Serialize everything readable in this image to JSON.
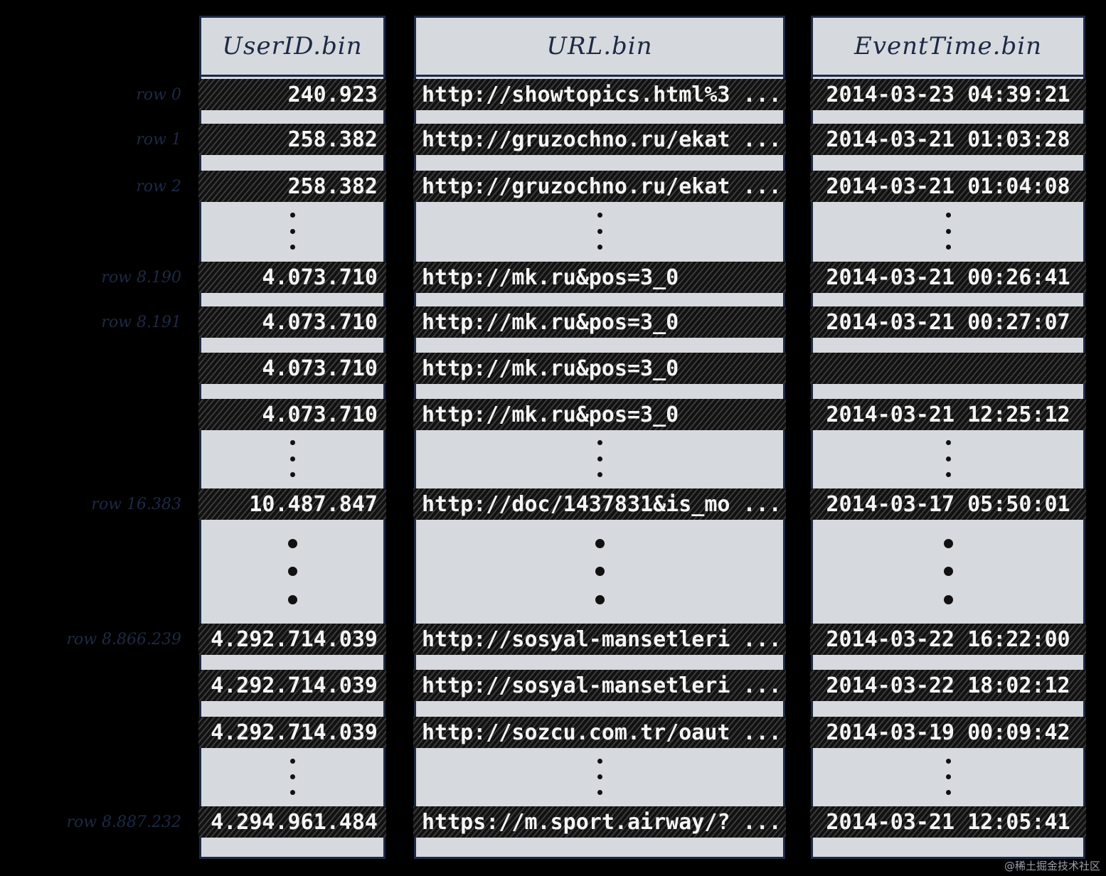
{
  "columns": [
    {
      "header": "UserID.bin",
      "rows": [
        "240.923",
        "258.382",
        "258.382",
        "4.073.710",
        "4.073.710",
        "4.073.710",
        "4.073.710",
        "10.487.847",
        "4.292.714.039",
        "4.292.714.039",
        "4.292.714.039",
        "4.294.961.484"
      ]
    },
    {
      "header": "URL.bin",
      "rows": [
        "http://showtopics.html%3 ...",
        "http://gruzochno.ru/ekat ...",
        "http://gruzochno.ru/ekat ...",
        "http://mk.ru&pos=3_0",
        "http://mk.ru&pos=3_0",
        "http://mk.ru&pos=3_0",
        "http://mk.ru&pos=3_0",
        "http://doc/1437831&is_mo ...",
        "http://sosyal-mansetleri ...",
        "http://sosyal-mansetleri ...",
        "http://sozcu.com.tr/oaut ...",
        "https://m.sport.airway/? ..."
      ]
    },
    {
      "header": "EventTime.bin",
      "rows": [
        "2014-03-23 04:39:21",
        "2014-03-21 01:03:28",
        "2014-03-21 01:04:08",
        "2014-03-21 00:26:41",
        "2014-03-21 00:27:07",
        "",
        "2014-03-21 12:25:12",
        "2014-03-17 05:50:01",
        "2014-03-22 16:22:00",
        "2014-03-22 18:02:12",
        "2014-03-19 00:09:42",
        "2014-03-21 12:05:41"
      ]
    }
  ],
  "row_labels": [
    "row 0",
    "row 1",
    "row 2",
    "row 8.190",
    "row 8.191",
    "",
    "",
    "row 16.383",
    "row 8.866.239",
    "",
    "",
    "row 8.887.232"
  ],
  "watermark": "@稀土掘金技术社区"
}
